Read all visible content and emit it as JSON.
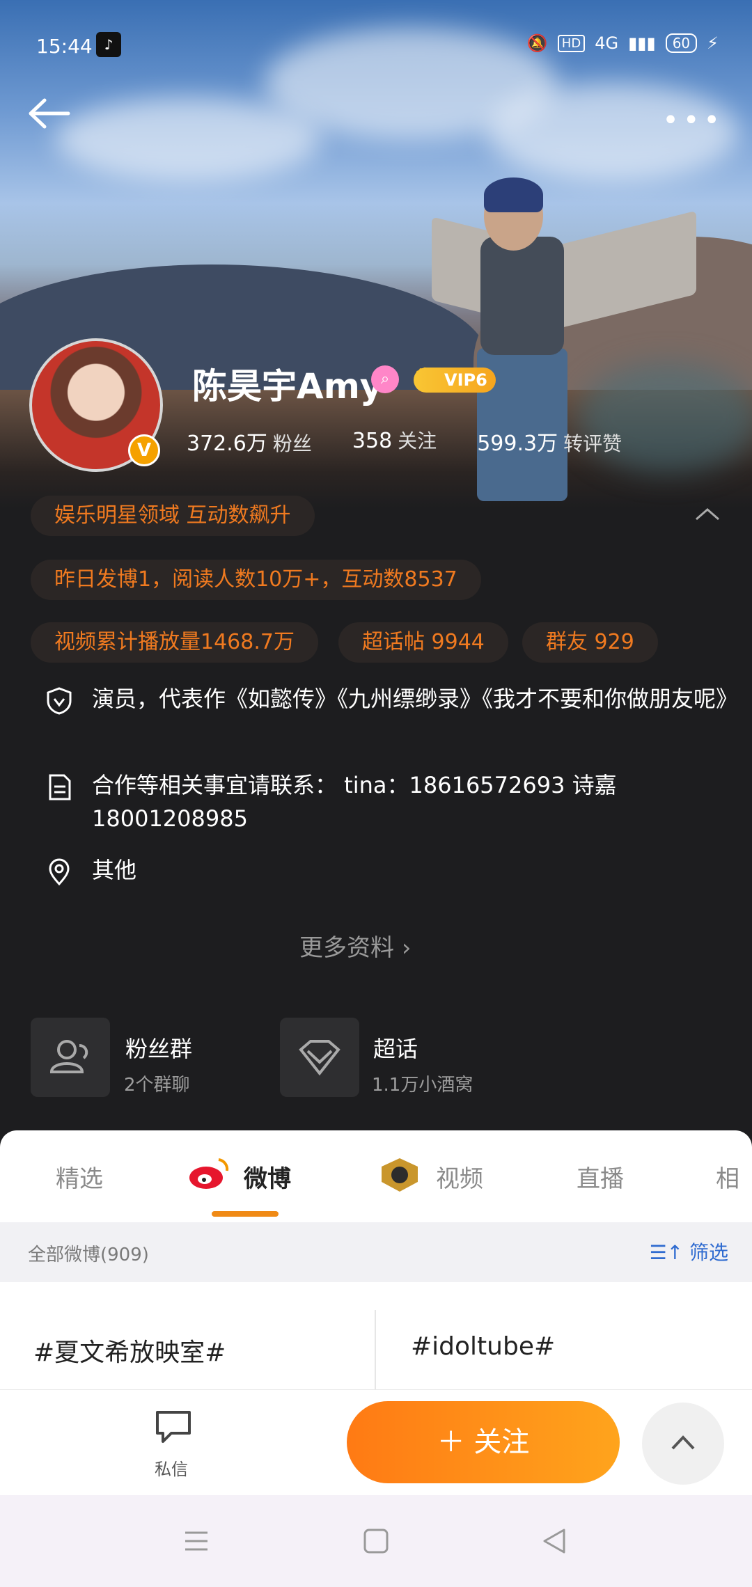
{
  "status_bar": {
    "time": "15:44",
    "app_badge": "♪",
    "hd": "HD",
    "network": "4G",
    "battery": "60"
  },
  "profile": {
    "name": "陈昊宇Amy",
    "vip": "VIP6",
    "stats": [
      {
        "value": "372.6万",
        "label": "粉丝"
      },
      {
        "value": "358",
        "label": "关注"
      },
      {
        "value": "599.3万",
        "label": "转评赞"
      }
    ]
  },
  "highlights": {
    "ranking": "娱乐明星领域 互动数飙升",
    "yesterday": "昨日发博1，阅读人数10万+，互动数8537",
    "video": "视频累计播放量1468.7万",
    "topic_posts": "超话帖 9944",
    "group_friends": "群友 929"
  },
  "info": {
    "bio": "演员，代表作《如懿传》《九州缥缈录》《我才不要和你做朋友呢》",
    "contact": "合作等相关事宜请联系： tina：18616572693 诗嘉 18001208985",
    "location": "其他",
    "more": "更多资料"
  },
  "cards": [
    {
      "title": "粉丝群",
      "subtitle": "2个群聊"
    },
    {
      "title": "超话",
      "subtitle": "1.1万小酒窝"
    }
  ],
  "tabs": [
    "精选",
    "微博",
    "视频",
    "直播",
    "相"
  ],
  "filter": {
    "count_text": "全部微博(909)",
    "filter_label": "筛选"
  },
  "posts": [
    {
      "tag": "#夏文希放映室#"
    },
    {
      "tag": "#idoltube#"
    }
  ],
  "actions": {
    "message_label": "私信",
    "follow_label": "关注"
  },
  "colors": {
    "accent": "#f08a15",
    "follow_start": "#ff7a14",
    "follow_end": "#ffa41c",
    "link_blue": "#2f6bd0",
    "pill_text": "#f07a20"
  }
}
